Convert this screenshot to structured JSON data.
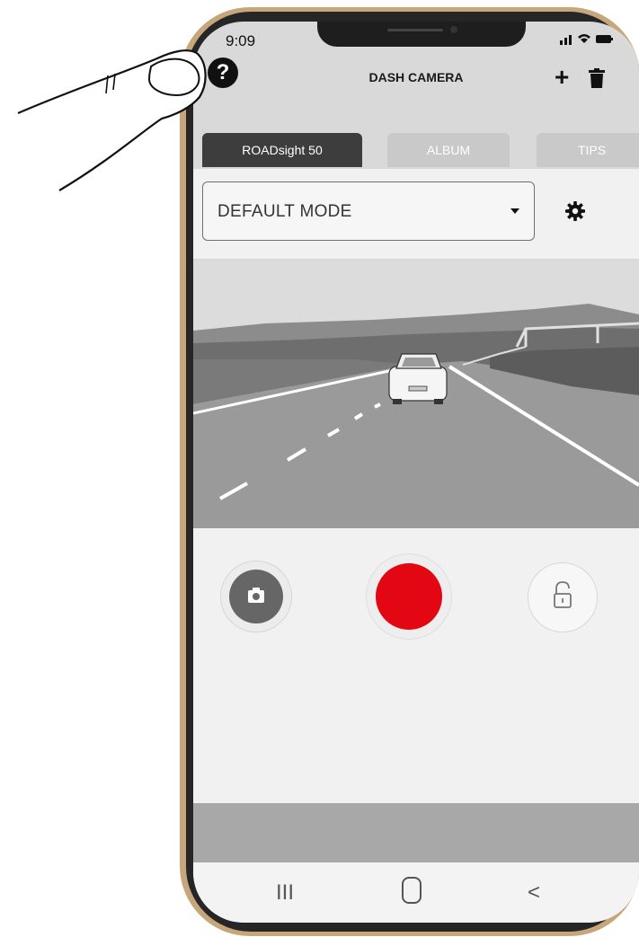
{
  "status": {
    "time": "9:09",
    "signal_icons": "signal-wifi-battery"
  },
  "header": {
    "title": "DASH CAMERA",
    "help_label": "?",
    "add_label": "+"
  },
  "tabs": [
    {
      "label": "ROADsight 50",
      "active": true
    },
    {
      "label": "ALBUM",
      "active": false
    },
    {
      "label": "TIPS",
      "active": false
    }
  ],
  "mode": {
    "selected": "DEFAULT MODE"
  },
  "controls": {
    "snapshot_icon": "camera-icon",
    "record_icon": "record-icon",
    "lock_icon": "unlock-icon"
  },
  "nav": {
    "recents": "III",
    "home": "O",
    "back": "<"
  },
  "colors": {
    "record": "#e30613",
    "active_tab": "#3d3d3d",
    "frame": "#c7a67c"
  }
}
